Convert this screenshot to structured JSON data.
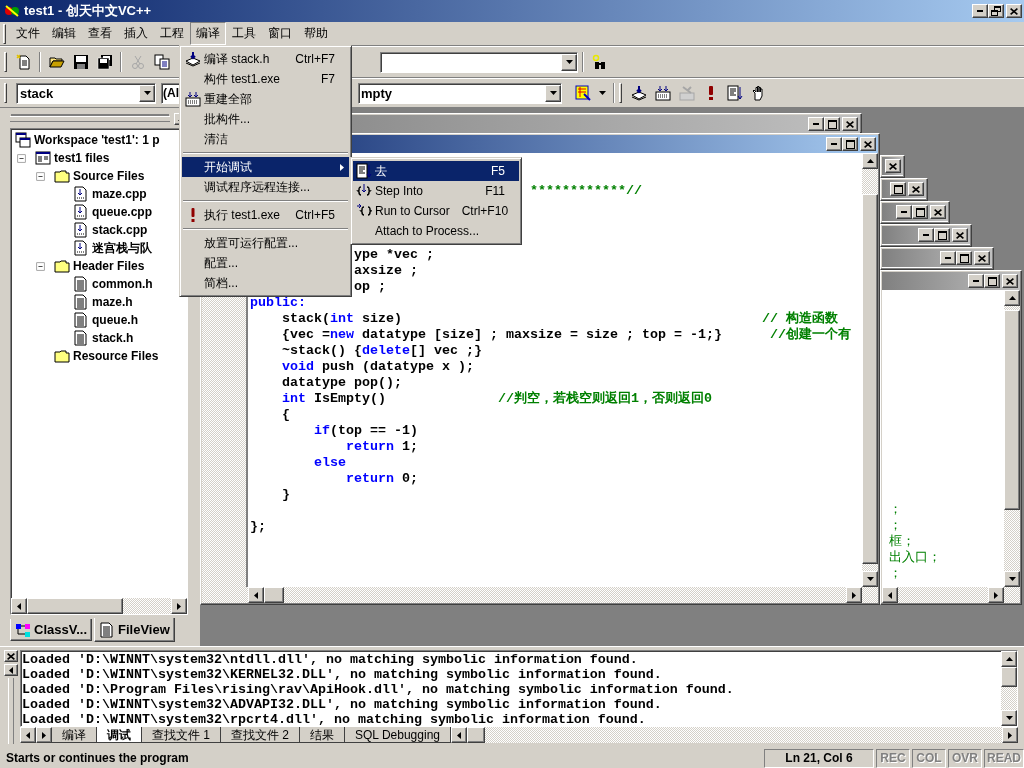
{
  "window": {
    "title": "test1 - 创天中文VC++"
  },
  "menu_bar": [
    {
      "label": "文件",
      "selected": false
    },
    {
      "label": "编辑",
      "selected": false
    },
    {
      "label": "查看",
      "selected": false
    },
    {
      "label": "插入",
      "selected": false
    },
    {
      "label": "工程",
      "selected": false
    },
    {
      "label": "编译",
      "selected": true
    },
    {
      "label": "工具",
      "selected": false
    },
    {
      "label": "窗口",
      "selected": false
    },
    {
      "label": "帮助",
      "selected": false
    }
  ],
  "standard_toolbar": [
    {
      "disabled": false
    },
    {
      "disabled": false
    },
    {
      "disabled": false
    },
    {
      "disabled": false
    },
    {
      "disabled": true
    },
    {
      "disabled": false
    }
  ],
  "context_combos": [
    {
      "value": "stack"
    },
    {
      "value": "(Al"
    },
    {
      "value": "mpty"
    }
  ],
  "build_toolbar": [
    {
      "disabled": false
    },
    {
      "disabled": false
    },
    {
      "disabled": true
    },
    {
      "disabled": false
    },
    {
      "disabled": false
    },
    {
      "disabled": false
    }
  ],
  "build_menu": [
    {
      "kind": "command",
      "label": "编译 stack.h",
      "shortcut": "Ctrl+F7",
      "selected": false
    },
    {
      "kind": "command",
      "label": "构件 test1.exe",
      "shortcut": "F7",
      "selected": false
    },
    {
      "kind": "command",
      "label": "重建全部",
      "selected": false
    },
    {
      "kind": "command",
      "label": "批构件...",
      "selected": false
    },
    {
      "kind": "command",
      "label": "清洁",
      "selected": false
    },
    {
      "kind": "separator"
    },
    {
      "kind": "submenu",
      "label": "开始调试",
      "selected": true
    },
    {
      "kind": "command",
      "label": "调试程序远程连接...",
      "selected": false
    },
    {
      "kind": "separator"
    },
    {
      "kind": "command",
      "label": "执行 test1.exe",
      "shortcut": "Ctrl+F5",
      "selected": false
    },
    {
      "kind": "separator"
    },
    {
      "kind": "command",
      "label": "放置可运行配置...",
      "selected": false
    },
    {
      "kind": "command",
      "label": "配置...",
      "selected": false
    },
    {
      "kind": "command",
      "label": "简档...",
      "selected": false
    }
  ],
  "debug_submenu": [
    {
      "label": "去",
      "shortcut": "F5",
      "selected": true
    },
    {
      "label": "Step Into",
      "shortcut": "F11",
      "selected": false
    },
    {
      "label": "Run to Cursor",
      "shortcut": "Ctrl+F10",
      "selected": false
    },
    {
      "label": "Attach to Process...",
      "selected": false
    }
  ],
  "workspace": {
    "tree": [
      {
        "kind": "workspace",
        "label": "Workspace 'test1': 1 p",
        "children": [
          {
            "kind": "project",
            "label": "test1 files",
            "expanded": true,
            "children": [
              {
                "kind": "folder",
                "label": "Source Files",
                "expanded": true,
                "children": [
                  {
                    "kind": "source",
                    "label": "maze.cpp"
                  },
                  {
                    "kind": "source",
                    "label": "queue.cpp"
                  },
                  {
                    "kind": "source",
                    "label": "stack.cpp"
                  },
                  {
                    "kind": "source",
                    "label": "迷宫栈与队"
                  }
                ]
              },
              {
                "kind": "folder",
                "label": "Header Files",
                "expanded": true,
                "children": [
                  {
                    "kind": "header",
                    "label": "common.h"
                  },
                  {
                    "kind": "header",
                    "label": "maze.h"
                  },
                  {
                    "kind": "header",
                    "label": "queue.h"
                  },
                  {
                    "kind": "header",
                    "label": "stack.h"
                  }
                ]
              },
              {
                "kind": "folder",
                "label": "Resource Files"
              }
            ]
          }
        ]
      }
    ],
    "tabs": [
      {
        "label": "ClassV...",
        "selected": false
      },
      {
        "label": "FileView",
        "selected": true
      }
    ]
  },
  "background_windows": [
    {
      "active": false
    },
    {
      "active": false
    },
    {
      "active": false
    },
    {
      "active": false
    },
    {
      "active": false
    },
    {
      "active": false
    },
    {
      "active": false,
      "lines": [
        "；",
        "；",
        "框；",
        "出入口；",
        "；"
      ]
    }
  ],
  "code_window": {
    "active": true,
    "lines": [
      {
        "tokens": [
          {
            "kind": "comment",
            "text": "                                   ************//"
          }
        ]
      },
      {
        "tokens": [
          {
            "kind": "plain",
            "text": "             ype *vec ;"
          }
        ]
      },
      {
        "tokens": [
          {
            "kind": "plain",
            "text": "             axsize ;"
          }
        ]
      },
      {
        "tokens": [
          {
            "kind": "plain",
            "text": "             op ;"
          }
        ]
      },
      {
        "tokens": [
          {
            "kind": "keyword",
            "text": "public:"
          }
        ]
      },
      {
        "tokens": [
          {
            "kind": "plain",
            "text": "    stack("
          },
          {
            "kind": "keyword",
            "text": "int"
          },
          {
            "kind": "plain",
            "text": " size)                                             "
          },
          {
            "kind": "comment",
            "text": "// 构造函数"
          }
        ]
      },
      {
        "tokens": [
          {
            "kind": "plain",
            "text": "    {vec ="
          },
          {
            "kind": "keyword",
            "text": "new"
          },
          {
            "kind": "plain",
            "text": " datatype [size] ; maxsize = size ; top = -1;}      "
          },
          {
            "kind": "comment",
            "text": "//创建一个有"
          }
        ]
      },
      {
        "tokens": [
          {
            "kind": "plain",
            "text": "    ~stack() {"
          },
          {
            "kind": "keyword",
            "text": "delete"
          },
          {
            "kind": "plain",
            "text": "[] vec ;}"
          }
        ]
      },
      {
        "tokens": [
          {
            "kind": "keyword",
            "text": "    void"
          },
          {
            "kind": "plain",
            "text": " push (datatype x );"
          }
        ]
      },
      {
        "tokens": [
          {
            "kind": "plain",
            "text": "    datatype pop();"
          }
        ]
      },
      {
        "tokens": [
          {
            "kind": "keyword",
            "text": "    int"
          },
          {
            "kind": "plain",
            "text": " IsEmpty()              "
          },
          {
            "kind": "comment",
            "text": "//判空，若栈空则返回1，否则返回0"
          }
        ]
      },
      {
        "tokens": [
          {
            "kind": "plain",
            "text": "    {"
          }
        ]
      },
      {
        "tokens": [
          {
            "kind": "keyword",
            "text": "        if"
          },
          {
            "kind": "plain",
            "text": "(top == -1)"
          }
        ]
      },
      {
        "tokens": [
          {
            "kind": "keyword",
            "text": "            return"
          },
          {
            "kind": "plain",
            "text": " 1;"
          }
        ]
      },
      {
        "tokens": [
          {
            "kind": "keyword",
            "text": "        else"
          }
        ]
      },
      {
        "tokens": [
          {
            "kind": "keyword",
            "text": "            return"
          },
          {
            "kind": "plain",
            "text": " 0;"
          }
        ]
      },
      {
        "tokens": [
          {
            "kind": "plain",
            "text": "    }"
          }
        ]
      },
      {
        "tokens": [
          {
            "kind": "plain",
            "text": "};"
          }
        ]
      }
    ]
  },
  "output": {
    "lines": [
      "Loaded 'D:\\WINNT\\system32\\ntdll.dll', no matching symbolic information found.",
      "Loaded 'D:\\WINNT\\system32\\KERNEL32.DLL', no matching symbolic information found.",
      "Loaded 'D:\\Program Files\\rising\\rav\\ApiHook.dll', no matching symbolic information found.",
      "Loaded 'D:\\WINNT\\system32\\ADVAPI32.DLL', no matching symbolic information found.",
      "Loaded 'D:\\WINNT\\system32\\rpcrt4.dll', no matching symbolic information found."
    ],
    "tabs": [
      {
        "label": "编译",
        "selected": false
      },
      {
        "label": "调试",
        "selected": true
      },
      {
        "label": "查找文件 1",
        "selected": false
      },
      {
        "label": "查找文件 2",
        "selected": false
      },
      {
        "label": "结果",
        "selected": false
      },
      {
        "label": "SQL Debugging",
        "selected": false
      }
    ]
  },
  "status_bar": {
    "message": "Starts or continues the program",
    "position": "Ln 21, Col 6",
    "indicators": [
      {
        "label": "REC",
        "disabled": true
      },
      {
        "label": "COL",
        "disabled": true
      },
      {
        "label": "OVR",
        "disabled": true
      },
      {
        "label": "READ",
        "disabled": true
      }
    ]
  }
}
